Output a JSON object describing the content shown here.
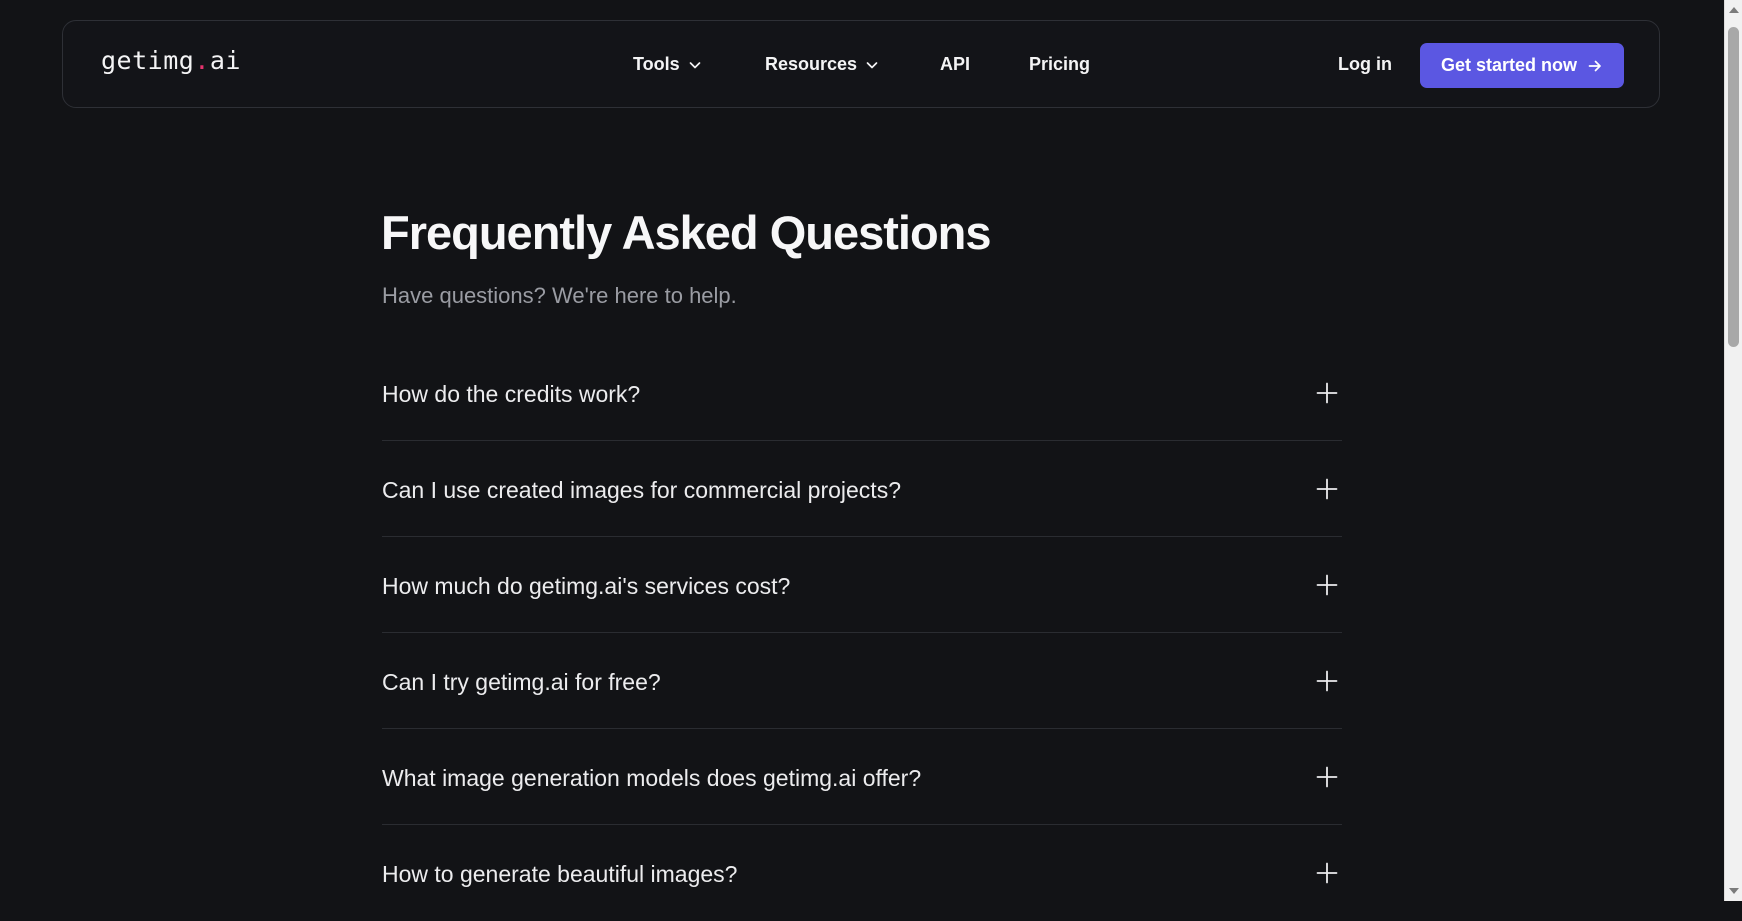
{
  "header": {
    "logo_main": "getimg",
    "logo_dot": ".",
    "logo_suffix": "ai",
    "nav": [
      {
        "label": "Tools",
        "has_dropdown": true,
        "icon": "chevron-down-icon"
      },
      {
        "label": "Resources",
        "has_dropdown": true,
        "icon": "chevron-down-icon"
      },
      {
        "label": "API",
        "has_dropdown": false
      },
      {
        "label": "Pricing",
        "has_dropdown": false
      }
    ],
    "login_label": "Log in",
    "cta_label": "Get started now",
    "cta_icon": "arrow-right-icon"
  },
  "faq": {
    "title": "Frequently Asked Questions",
    "subtitle": "Have questions? We're here to help.",
    "items": [
      {
        "question": "How do the credits work?"
      },
      {
        "question": "Can I use created images for commercial projects?"
      },
      {
        "question": "How much do getimg.ai's services cost?"
      },
      {
        "question": "Can I try getimg.ai for free?"
      },
      {
        "question": "What image generation models does getimg.ai offer?"
      },
      {
        "question": "How to generate beautiful images?"
      }
    ],
    "item_icon": "plus-icon"
  },
  "colors": {
    "background": "#121316",
    "accent": "#5b57e2",
    "logo_dot": "#e6336d",
    "muted_text": "#9a9ca3",
    "divider": "#2a2c31"
  }
}
